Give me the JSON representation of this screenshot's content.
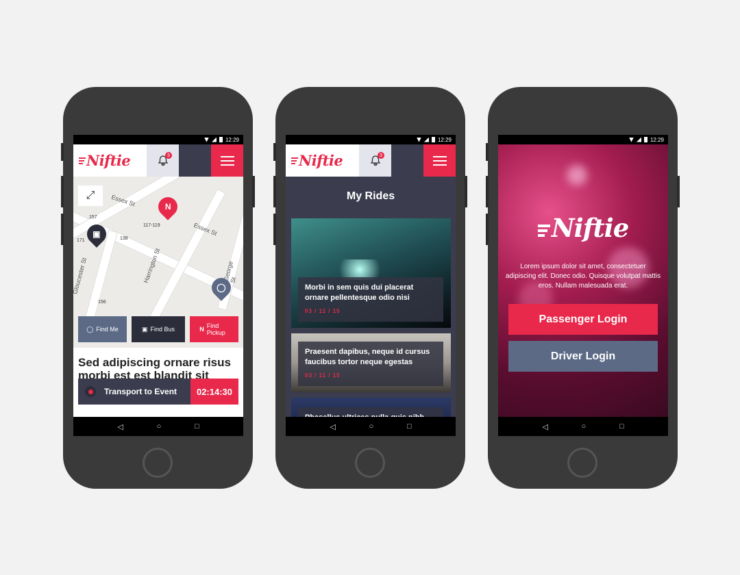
{
  "status": {
    "time": "12:29"
  },
  "brand": {
    "name": "Niftie",
    "accent": "#e8294b",
    "dark": "#3b3d4e"
  },
  "header": {
    "notifications_count": "3"
  },
  "map_screen": {
    "streets": [
      "Essex St",
      "Essex St",
      "Harrington St",
      "Gloucester St",
      "George St"
    ],
    "numbers": [
      "157",
      "171",
      "138",
      "117-119",
      "156"
    ],
    "buttons": {
      "find_me": "Find Me",
      "find_bus": "Find Bus",
      "find_pickup": "Find Pickup"
    },
    "headline": "Sed adipiscing ornare risus morbi est est blandit sit",
    "transport_label": "Transport to Event",
    "transport_timer": "02:14:30"
  },
  "rides_screen": {
    "title": "My Rides",
    "rides": [
      {
        "text": "Morbi in sem quis dui placerat ornare pellentesque odio nisi",
        "date": "03 / 11 / 15"
      },
      {
        "text": "Praesent dapibus, neque id cursus faucibus tortor neque egestas",
        "date": "03 / 11 / 15"
      },
      {
        "text": "Phasellus ultrices nulla quis nibh",
        "date": ""
      }
    ]
  },
  "login_screen": {
    "logo": "Niftie",
    "body": "Lorem ipsum dolor sit amet, consectetuer adipiscing elit. Donec odio. Quisque volutpat mattis eros. Nullam malesuada erat.",
    "passenger_button": "Passenger Login",
    "driver_button": "Driver Login"
  },
  "icons": [
    "wifi-icon",
    "signal-icon",
    "battery-icon",
    "bell-icon",
    "map-icon",
    "menu-icon",
    "expand-icon",
    "bus-icon",
    "person-icon",
    "back-icon",
    "home-icon",
    "recents-icon"
  ]
}
